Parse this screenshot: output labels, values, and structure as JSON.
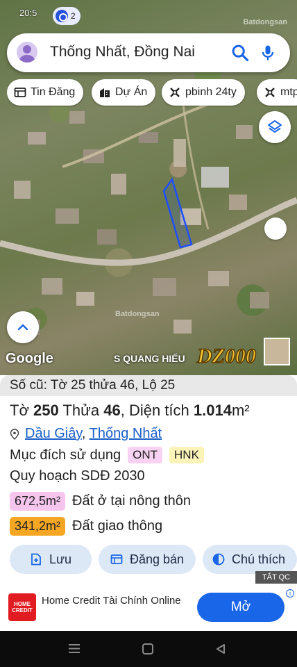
{
  "status_bar": {
    "time": "20:5",
    "notification_count": "2"
  },
  "map": {
    "watermark_top": "Batdongsan",
    "watermark_mid": "Batdongsan",
    "google_logo": "Google",
    "overlay_text": "S QUANG HIẾU",
    "streamer_logo": "DZ000",
    "highlight_color": "#1e4fff"
  },
  "search": {
    "text": "Thống Nhất, Đồng Nai",
    "icons": [
      "avatar-icon",
      "search-icon",
      "mic-icon"
    ]
  },
  "chips": [
    {
      "label": "Tin Đăng",
      "icon": "listing-icon"
    },
    {
      "label": "Dự Án",
      "icon": "building-icon"
    },
    {
      "label": "pbinh 24ty",
      "icon": "cross-icon"
    },
    {
      "label": "mtp",
      "icon": "cross-icon"
    }
  ],
  "panel": {
    "old_parcel": "Số cũ: Tờ 25 thửa 46, Lộ 25",
    "sheet_label": "Tờ",
    "sheet": "250",
    "plot_label": "Thửa",
    "plot": "46",
    "area_label": "Diện tích",
    "area": "1.014",
    "area_unit": "m²",
    "location_a": "Dầu Giây",
    "location_sep": ",",
    "location_b": "Thống Nhất",
    "purpose_label": "Mục đích sử dụng",
    "purpose_codes": [
      "ONT",
      "HNK"
    ],
    "plan": "Quy hoạch SDĐ 2030",
    "areas": [
      {
        "value": "672,5m²",
        "label": "Đất ở tại nông thôn",
        "color": "#f6c5ee"
      },
      {
        "value": "341,2m²",
        "label": "Đất giao thông",
        "color": "#f5a623"
      }
    ],
    "actions": [
      {
        "label": "Lưu",
        "icon": "save-plus-icon"
      },
      {
        "label": "Đăng bán",
        "icon": "listing-icon"
      },
      {
        "label": "Chú thích",
        "icon": "legend-icon"
      }
    ]
  },
  "ad": {
    "close_label": "TẮT QC",
    "logo_text": "HOME CREDIT",
    "title": "Home Credit Tài Chính Online",
    "cta": "Mở",
    "info": "i"
  }
}
